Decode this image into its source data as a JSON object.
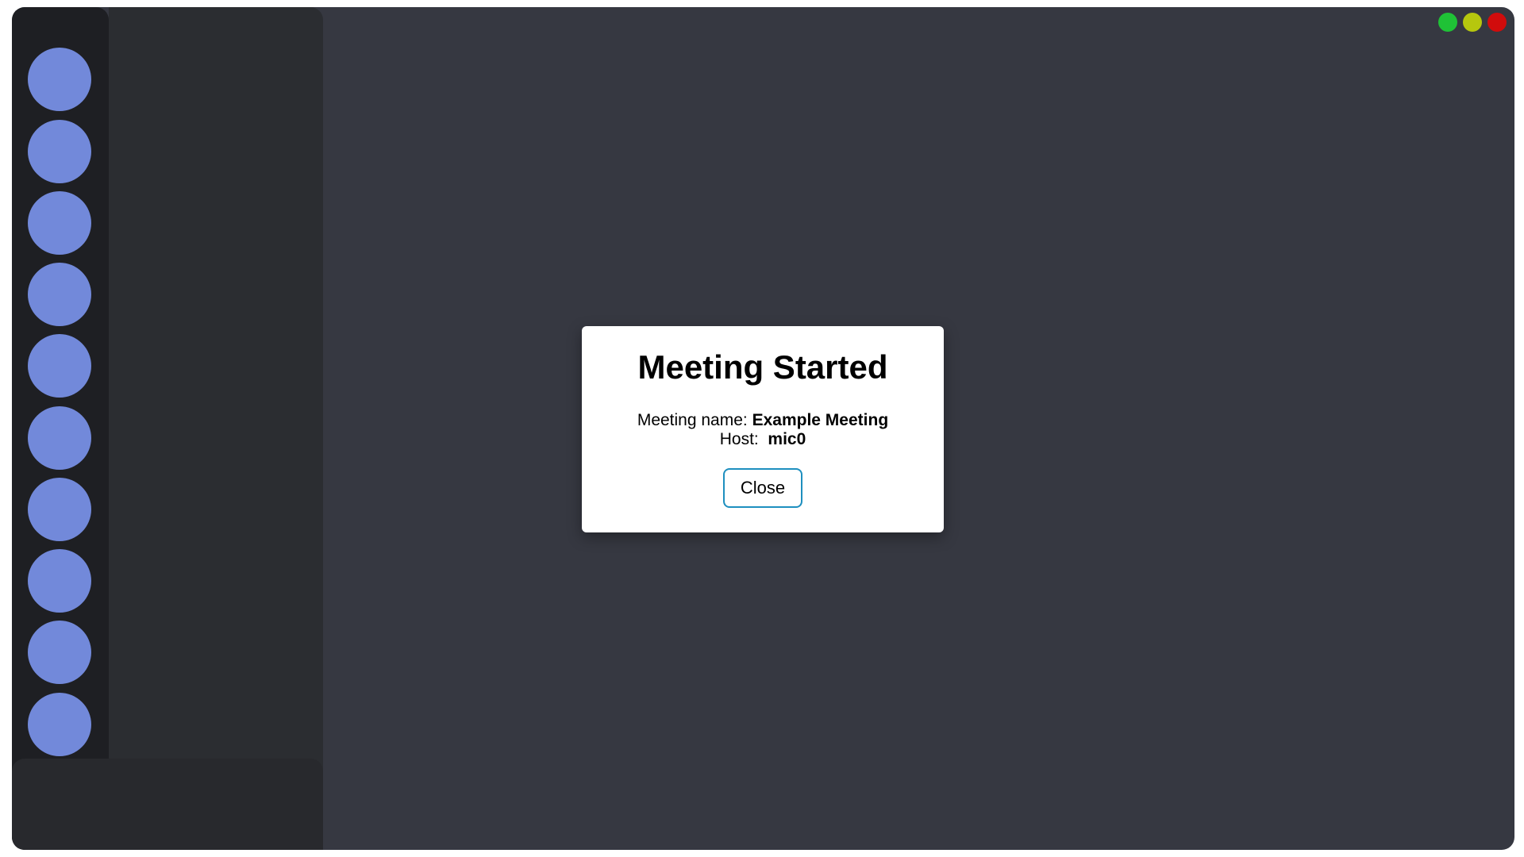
{
  "colors": {
    "background": "#363841",
    "rail": "#1e1f23",
    "channel_panel": "#2b2d31",
    "user_panel": "#28292d",
    "server_avatar": "#7289da",
    "button_border": "#1e8fbf"
  },
  "window_controls": [
    {
      "name": "maximize",
      "color": "#1fc236"
    },
    {
      "name": "minimize",
      "color": "#b6c70e"
    },
    {
      "name": "close",
      "color": "#d10c0c"
    }
  ],
  "server_rail": {
    "server_count": 10
  },
  "modal": {
    "title": "Meeting Started",
    "meeting_name_label": "Meeting name:",
    "meeting_name_value": "Example Meeting",
    "host_label": "Host:",
    "host_value": "mic0",
    "close_label": "Close"
  }
}
